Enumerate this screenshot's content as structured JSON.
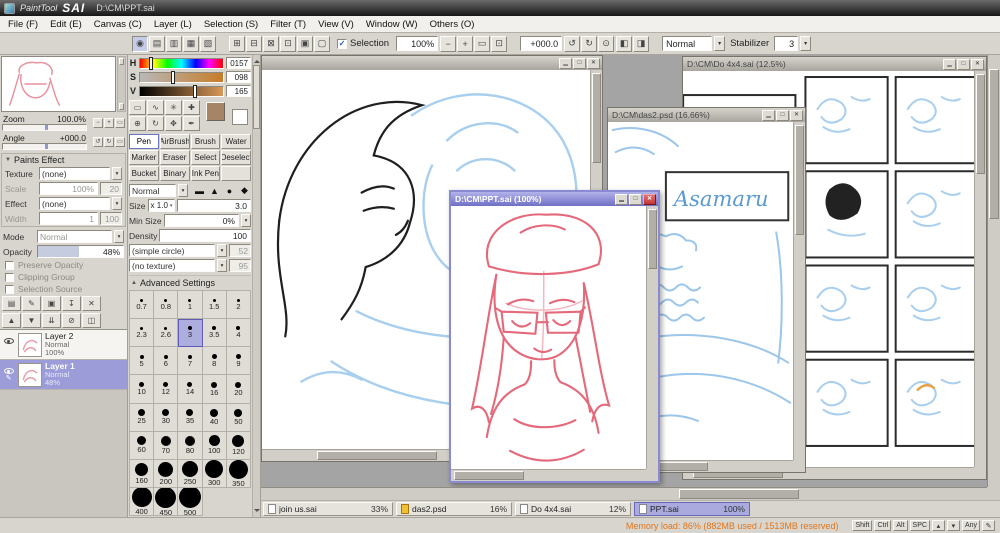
{
  "ui": {
    "dropdown_arrow": "▾",
    "collapse_arrow": "▼",
    "expand_arrow": "▲",
    "pen_icon": "✎"
  },
  "titlebar": {
    "app_name": "PaintTool",
    "app_sai": "SAI",
    "doc_path": "D:\\CM\\PPT.sai"
  },
  "menubar": {
    "items": [
      {
        "label": "File (F)"
      },
      {
        "label": "Edit (E)"
      },
      {
        "label": "Canvas (C)"
      },
      {
        "label": "Layer (L)"
      },
      {
        "label": "Selection (S)"
      },
      {
        "label": "Filter (T)"
      },
      {
        "label": "View (V)"
      },
      {
        "label": "Window (W)"
      },
      {
        "label": "Others (O)"
      }
    ]
  },
  "toolbar": {
    "panel_tabs": [
      {
        "id": "color-wheel-tab",
        "glyph": "◉",
        "selected": true
      },
      {
        "id": "rgb-slider-tab",
        "glyph": "▤"
      },
      {
        "id": "hsv-slider-tab",
        "glyph": "▥"
      },
      {
        "id": "swatches-tab",
        "glyph": "▦"
      },
      {
        "id": "scratchpad-tab",
        "glyph": "▧"
      }
    ],
    "view_buttons": [
      {
        "id": "new-view-button",
        "glyph": "⊞"
      },
      {
        "id": "prev-view-button",
        "glyph": "⊟"
      },
      {
        "id": "next-view-button",
        "glyph": "⊠"
      },
      {
        "id": "show-selection-button",
        "glyph": "⊡"
      },
      {
        "id": "show-grid-button",
        "glyph": "▣"
      },
      {
        "id": "reset-view-button",
        "glyph": "▢"
      }
    ],
    "selection": {
      "label": "Selection",
      "check": "✓"
    },
    "zoom": {
      "value": "100%",
      "buttons": [
        {
          "id": "zoom-out-button",
          "glyph": "−"
        },
        {
          "id": "zoom-in-button",
          "glyph": "+"
        },
        {
          "id": "zoom-reset-button",
          "glyph": "▭"
        },
        {
          "id": "fit-window-button",
          "glyph": "⊡"
        }
      ]
    },
    "angle": {
      "value": "+000.0",
      "buttons": [
        {
          "id": "rotate-ccw-button",
          "glyph": "↺"
        },
        {
          "id": "rotate-cw-button",
          "glyph": "↻"
        },
        {
          "id": "angle-reset-button",
          "glyph": "⊙"
        }
      ]
    },
    "extra_buttons": [
      {
        "id": "flip-horizontal-button",
        "glyph": "◧"
      },
      {
        "id": "flip-vertical-button",
        "glyph": "◨"
      }
    ],
    "mode_value": "Normal",
    "stabilizer_label": "Stabilizer",
    "stabilizer_value": "3"
  },
  "navigator": {
    "zoom_label": "Zoom",
    "zoom_value": "100.0%",
    "zoom_buttons": [
      {
        "id": "nav-zoom-out-button",
        "glyph": "−"
      },
      {
        "id": "nav-zoom-in-button",
        "glyph": "+"
      },
      {
        "id": "nav-zoom-reset-button",
        "glyph": "▭"
      }
    ],
    "angle_label": "Angle",
    "angle_value": "+000.0",
    "angle_buttons": [
      {
        "id": "nav-rotate-ccw-button",
        "glyph": "↺"
      },
      {
        "id": "nav-rotate-cw-button",
        "glyph": "↻"
      },
      {
        "id": "nav-angle-reset-button",
        "glyph": "▭"
      }
    ]
  },
  "paints_effect": {
    "title": "Paints Effect",
    "texture_label": "Texture",
    "texture_value": "(none)",
    "scale_label": "Scale",
    "scale_value": "100%",
    "scale_num": "20",
    "effect_label": "Effect",
    "effect_value": "(none)",
    "width_label": "Width",
    "width_value": "1",
    "width_num": "100"
  },
  "layer_panel": {
    "mode_label": "Mode",
    "mode_value": "Normal",
    "opacity_label": "Opacity",
    "opacity_value": "48%",
    "options": [
      {
        "label": "Preserve Opacity"
      },
      {
        "label": "Clipping Group"
      },
      {
        "label": "Selection Source"
      }
    ],
    "tool_row1": [
      {
        "id": "new-layer-button",
        "glyph": "▤"
      },
      {
        "id": "new-linework-layer-button",
        "glyph": "✎"
      },
      {
        "id": "new-layer-set-button",
        "glyph": "▣"
      },
      {
        "id": "transfer-down-button",
        "glyph": "↧"
      },
      {
        "id": "delete-layer-button",
        "glyph": "✕"
      }
    ],
    "tool_row2": [
      {
        "id": "raise-layer-button",
        "glyph": "▲"
      },
      {
        "id": "lower-layer-button",
        "glyph": "▼"
      },
      {
        "id": "merge-down-button",
        "glyph": "⇊"
      },
      {
        "id": "clear-layer-button",
        "glyph": "⊘"
      },
      {
        "id": "lock-alpha-button",
        "glyph": "◫"
      }
    ],
    "layers": [
      {
        "name": "Layer 2",
        "mode": "Normal",
        "opacity": "100%"
      },
      {
        "name": "Layer 1",
        "mode": "Normal",
        "opacity": "48%",
        "selected": true
      }
    ]
  },
  "color_panel": {
    "h_label": "H",
    "h_value": "0157",
    "s_label": "S",
    "s_value": "098",
    "v_label": "V",
    "v_value": "165"
  },
  "tool_panel": {
    "quick_icons": [
      {
        "id": "rect-select-icon",
        "glyph": "▭"
      },
      {
        "id": "lasso-icon",
        "glyph": "∿"
      },
      {
        "id": "magic-wand-icon",
        "glyph": "✳"
      },
      {
        "id": "move-icon",
        "glyph": "✚"
      },
      {
        "id": "zoom-tool-icon",
        "glyph": "⊕"
      },
      {
        "id": "rotate-tool-icon",
        "glyph": "↻"
      },
      {
        "id": "hand-tool-icon",
        "glyph": "✥"
      },
      {
        "id": "eyedropper-icon",
        "glyph": "✒"
      }
    ],
    "tools": [
      {
        "label": "Pen",
        "selected": true
      },
      {
        "label": "AirBrush"
      },
      {
        "label": "Brush"
      },
      {
        "label": "Water"
      },
      {
        "label": "Marker"
      },
      {
        "label": "Eraser"
      },
      {
        "label": "Select"
      },
      {
        "label": "Deselect"
      },
      {
        "label": "Bucket"
      },
      {
        "label": "Binary"
      },
      {
        "label": "Ink Pen"
      },
      {
        "label": ""
      }
    ]
  },
  "brush_panel": {
    "blend_value": "Normal",
    "tips": [
      {
        "id": "brush-tip-flat-icon",
        "glyph": "▬"
      },
      {
        "id": "brush-tip-triangle-icon",
        "glyph": "▲"
      },
      {
        "id": "brush-tip-circle-icon",
        "glyph": "●"
      },
      {
        "id": "brush-tip-diamond-icon",
        "glyph": "◆"
      }
    ],
    "size_label": "Size",
    "size_unit": "x 1.0",
    "size_value": "3.0",
    "min_size_label": "Min Size",
    "min_size_value": "0%",
    "density_label": "Density",
    "density_value": "100",
    "shape_value": "(simple circle)",
    "shape_num": "52",
    "texture_value": "(no texture)",
    "texture_num": "95",
    "advanced_label": "Advanced Settings",
    "sizes": [
      {
        "v": 0.7,
        "label": "0.7"
      },
      {
        "v": 0.8,
        "label": "0.8"
      },
      {
        "v": 1,
        "label": "1"
      },
      {
        "v": 1.5,
        "label": "1.5"
      },
      {
        "v": 2,
        "label": "2"
      },
      {
        "v": 2.3,
        "label": "2.3"
      },
      {
        "v": 2.6,
        "label": "2.6"
      },
      {
        "v": 3,
        "label": "3",
        "selected": true
      },
      {
        "v": 3.5,
        "label": "3.5"
      },
      {
        "v": 4,
        "label": "4"
      },
      {
        "v": 5,
        "label": "5"
      },
      {
        "v": 6,
        "label": "6"
      },
      {
        "v": 7,
        "label": "7"
      },
      {
        "v": 8,
        "label": "8"
      },
      {
        "v": 9,
        "label": "9"
      },
      {
        "v": 10,
        "label": "10"
      },
      {
        "v": 12,
        "label": "12"
      },
      {
        "v": 14,
        "label": "14"
      },
      {
        "v": 16,
        "label": "16"
      },
      {
        "v": 20,
        "label": "20"
      },
      {
        "v": 25,
        "label": "25"
      },
      {
        "v": 30,
        "label": "30"
      },
      {
        "v": 35,
        "label": "35"
      },
      {
        "v": 40,
        "label": "40"
      },
      {
        "v": 50,
        "label": "50"
      },
      {
        "v": 60,
        "label": "60"
      },
      {
        "v": 70,
        "label": "70"
      },
      {
        "v": 80,
        "label": "80"
      },
      {
        "v": 100,
        "label": "100"
      },
      {
        "v": 120,
        "label": "120"
      },
      {
        "v": 160,
        "label": "160"
      },
      {
        "v": 200,
        "label": "200"
      },
      {
        "v": 250,
        "label": "250"
      },
      {
        "v": 300,
        "label": "300"
      },
      {
        "v": 350,
        "label": "350"
      },
      {
        "v": 400,
        "label": "400"
      },
      {
        "v": 450,
        "label": "450"
      },
      {
        "v": 500,
        "label": "500"
      }
    ]
  },
  "canvas": {
    "join_window": {
      "title": ""
    },
    "do_window": {
      "title": "D:\\CM\\Do 4x4.sai (12.5%)"
    },
    "das_window": {
      "title": "D:\\CM\\das2.psd (16.66%)"
    },
    "ppt_window": {
      "title": "D:\\CM\\PPT.sai (100%)"
    },
    "asamaru": "Asamaru",
    "win_buttons": {
      "min": "▁",
      "max": "□",
      "close": "✕"
    }
  },
  "taskbar": {
    "items": [
      {
        "name": "join us.sai",
        "zoom": "33%"
      },
      {
        "name": "das2.psd",
        "zoom": "16%"
      },
      {
        "name": "Do 4x4.sai",
        "zoom": "12%"
      },
      {
        "name": "PPT.sai",
        "zoom": "100%",
        "selected": true
      }
    ]
  },
  "statusbar": {
    "memory": "Memory load: 86% (882MB used / 1513MB reserved)",
    "keys": [
      {
        "label": "Shift"
      },
      {
        "label": "Ctrl"
      },
      {
        "label": "Alt"
      },
      {
        "label": "SPC"
      },
      {
        "label": "▴"
      },
      {
        "label": "▾"
      },
      {
        "label": "Any"
      },
      {
        "label": "✎"
      }
    ]
  }
}
